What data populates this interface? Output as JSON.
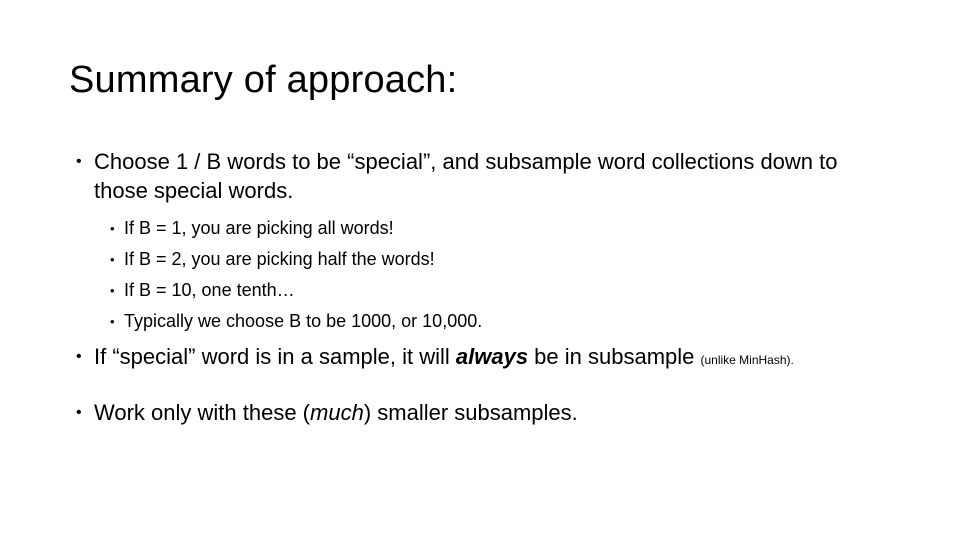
{
  "slide": {
    "title": "Summary of approach:",
    "background_color": "#ffffff",
    "text_color": "#000000",
    "bullet_glyph": "•"
  },
  "bullets": {
    "b1": {
      "text": "Choose 1 / B words to be “special”, and subsample word collections down to those special words."
    },
    "b3": {
      "part1": "If “special” word is in a sample, it will ",
      "emphasis": "always",
      "part2": " be in subsample ",
      "note": "(unlike MinHash)."
    },
    "b4": {
      "part1": "Work only with these (",
      "emphasis": "much",
      "part2": ") smaller subsamples."
    }
  },
  "sub_bullets": [
    {
      "text": "If B = 1, you are picking all words!"
    },
    {
      "text": "If B = 2, you are picking half the words!"
    },
    {
      "text": "If B = 10, one tenth…"
    },
    {
      "text": "Typically we choose B to be 1000, or 10,000."
    }
  ]
}
